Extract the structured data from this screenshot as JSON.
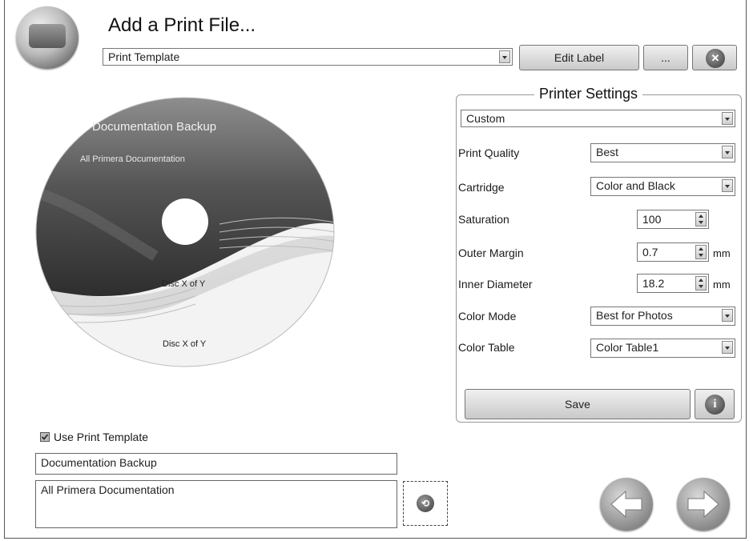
{
  "header": {
    "title": "Add a Print File...",
    "template_select": "Print Template",
    "edit_label_button": "Edit Label",
    "more_button": "...",
    "close_icon": "close-icon"
  },
  "disc_preview": {
    "title_text": "Documentation Backup",
    "subtitle_text": "All Primera Documentation",
    "disc_number_upper": "Disc X of Y",
    "disc_number_lower": "Disc X of Y"
  },
  "printer_settings": {
    "group_title": "Printer Settings",
    "preset": "Custom",
    "print_quality": {
      "label": "Print Quality",
      "value": "Best"
    },
    "cartridge": {
      "label": "Cartridge",
      "value": "Color and Black"
    },
    "saturation": {
      "label": "Saturation",
      "value": "100"
    },
    "outer_margin": {
      "label": "Outer Margin",
      "value": "0.7",
      "unit": "mm"
    },
    "inner_diameter": {
      "label": "Inner Diameter",
      "value": "18.2",
      "unit": "mm"
    },
    "color_mode": {
      "label": "Color Mode",
      "value": "Best for Photos"
    },
    "color_table": {
      "label": "Color Table",
      "value": "Color Table1"
    },
    "save_button": "Save",
    "info_icon": "info-icon"
  },
  "template_options": {
    "use_template_label": "Use Print Template",
    "use_template_checked": true,
    "field_1": "Documentation Backup",
    "field_2": "All Primera Documentation"
  },
  "navigation": {
    "back_icon": "arrow-left-icon",
    "next_icon": "arrow-right-icon"
  }
}
